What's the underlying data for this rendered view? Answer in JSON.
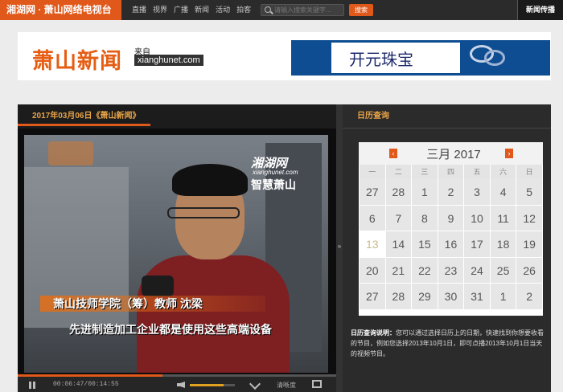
{
  "topbar": {
    "brand": "湘湖网 · 萧山网络电视台",
    "nav": [
      "直播",
      "视界",
      "广播",
      "新闻",
      "活动",
      "拍客"
    ],
    "search_placeholder": "请输入搜索关键字...",
    "search_button": "搜索",
    "right_label": "新闻传播"
  },
  "banner": {
    "logo_text": "萧山新闻",
    "logo_from": "来自",
    "logo_url": "xianghunet.com",
    "ad_text": "开元珠宝"
  },
  "video": {
    "title": "2017年03月06日《萧山新闻》",
    "watermark_main": "湘湖网",
    "watermark_url": "xianghunet.com",
    "watermark_sub": "智慧萧山",
    "caption_line1": "萧山技师学院（筹）教师  沈梁",
    "caption_line2": "先进制造加工企业都是使用这些高端设备",
    "time_display": "00:06:47/00:14:55",
    "progress_fraction": 0.455,
    "volume_fraction": 0.75,
    "clarity_label": "清晰度"
  },
  "calendar": {
    "section_title": "日历查询",
    "month_label": "三月 2017",
    "weekdays": [
      "一",
      "二",
      "三",
      "四",
      "五",
      "六",
      "日"
    ],
    "days": [
      "27",
      "28",
      "1",
      "2",
      "3",
      "4",
      "5",
      "6",
      "7",
      "8",
      "9",
      "10",
      "11",
      "12",
      "13",
      "14",
      "15",
      "16",
      "17",
      "18",
      "19",
      "20",
      "21",
      "22",
      "23",
      "24",
      "25",
      "26",
      "27",
      "28",
      "29",
      "30",
      "31",
      "1",
      "2"
    ],
    "highlight_day": "13",
    "note_label": "日历查询说明：",
    "note_text": "您可以通过选择日历上的日期，快速找到你想要收看的节目，例如您选择2013年10月1日，即可点播2013年10月1日当天的视频节目。"
  }
}
